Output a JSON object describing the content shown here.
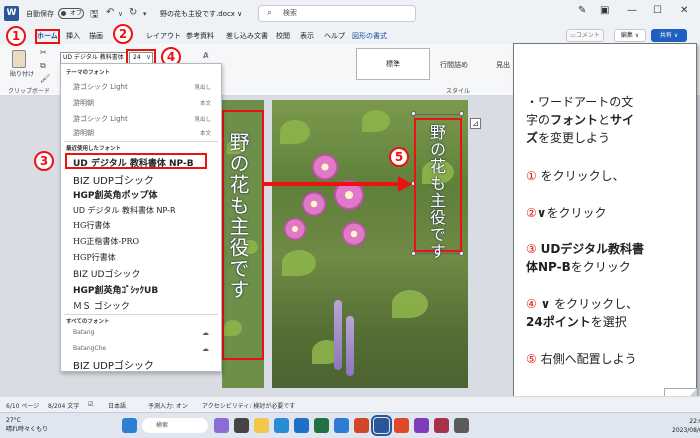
{
  "titlebar": {
    "autosave_label": "自動保存",
    "autosave_state": "オフ",
    "doc_title": "野の花も主役です.docx ∨",
    "search_placeholder": "検索"
  },
  "tabs": [
    "ホーム",
    "挿入",
    "描画",
    "レイアウト",
    "参考資料",
    "差し込み文書",
    "校閲",
    "表示",
    "ヘルプ",
    "図形の書式"
  ],
  "right_buttons": {
    "comment": "コメント",
    "edit": "編集 ∨",
    "share": "共有 ∨"
  },
  "ribbon": {
    "paste_label": "貼り付け",
    "clipboard_group": "クリップボード",
    "font_name": "UD デジタル 教科書体",
    "font_size": "24",
    "styles": [
      "標準",
      "行間詰め",
      "見出"
    ],
    "styles_group": "スタイル"
  },
  "font_dropdown": {
    "theme_header": "テーマのフォント",
    "theme_fonts": [
      {
        "name": "游ゴシック Light",
        "tag": "見出し"
      },
      {
        "name": "游明朝",
        "tag": "本文"
      },
      {
        "name": "游ゴシック Light",
        "tag": "見出し"
      },
      {
        "name": "游明朝",
        "tag": "本文"
      }
    ],
    "recent_header": "最近使用したフォント",
    "recent_fonts": [
      "UD デジタル 教科書体 NP-B",
      "BIZ UDPゴシック",
      "HGP創英角ポップ体",
      "UD デジタル 教科書体 NP-R",
      "HG行書体",
      "HG正楷書体-PRO",
      "HGP行書体",
      "BIZ UDゴシック",
      "HGP創英角ｺﾞｼｯｸUB",
      "ＭＳ ゴシック"
    ],
    "all_header": "すべてのフォント",
    "all_fonts": [
      "Batang",
      "BatangChe",
      "BIZ UDPゴシック"
    ]
  },
  "callouts": [
    "1",
    "2",
    "3",
    "4",
    "5"
  ],
  "document": {
    "wordart_left": "野の花も主役です",
    "wordart_right": "野の花も主役です"
  },
  "note": {
    "line1": "・ワードアートの文",
    "line2a": "字の",
    "line2b": "フォント",
    "line2c": "と",
    "line2d": "サイ",
    "line3a": "ズ",
    "line3b": "を変更しよう",
    "step1_num": "①",
    "step1": "をクリックし、",
    "step2_num": "②",
    "step2a": "∨",
    "step2b": "をクリック",
    "step3_num": "③",
    "step3a": "UDデジタル教科書",
    "step3b": "体NP-B",
    "step3c": "をクリック",
    "step4_num": "④",
    "step4a": "∨",
    "step4b": "をクリックし、",
    "step4c": "24ポイント",
    "step4d": "を選択",
    "step5_num": "⑤",
    "step5": "右側へ配置しよう"
  },
  "statusbar": {
    "page": "6/10 ページ",
    "words": "8/204 文字",
    "lang": "日本語",
    "predict": "予測入力: オン",
    "access": "アクセシビリティ: 検討が必要です"
  },
  "taskbar": {
    "temp": "27°C",
    "weather": "晴れ時々くもり",
    "search": "検索",
    "time": "22:03",
    "date": "2023/08/04"
  },
  "colors": {
    "accent": "#e11111",
    "word_blue": "#2b579a",
    "share_blue": "#1f5fbf"
  }
}
